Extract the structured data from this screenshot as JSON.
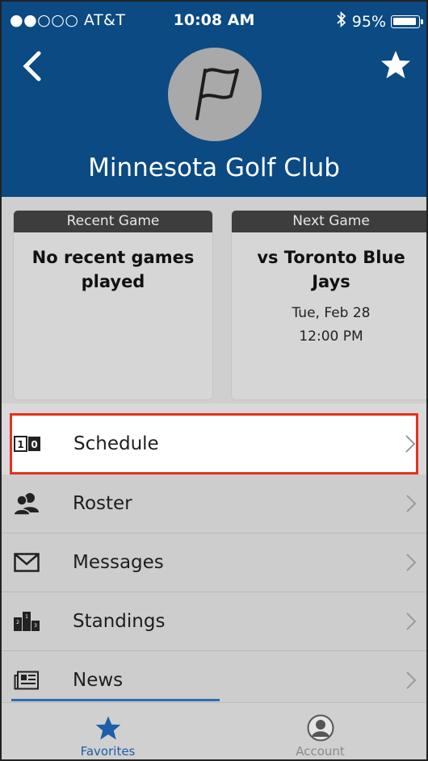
{
  "status_bar": {
    "carrier": "●●○○○ AT&T",
    "time": "10:08 AM",
    "battery": "95%"
  },
  "header": {
    "team_name": "Minnesota Golf Club",
    "back_icon": "chevron-left-icon",
    "favorite_icon": "star-icon",
    "logo_icon": "flag-icon"
  },
  "recent_game": {
    "label": "Recent Game",
    "text": "No recent games played"
  },
  "next_game": {
    "label": "Next Game",
    "opponent": "vs Toronto Blue Jays",
    "date": "Tue, Feb 28",
    "time": "12:00 PM"
  },
  "menu": {
    "items": [
      {
        "label": "Schedule",
        "icon": "scoreboard-icon"
      },
      {
        "label": "Roster",
        "icon": "people-icon"
      },
      {
        "label": "Messages",
        "icon": "envelope-icon"
      },
      {
        "label": "Standings",
        "icon": "podium-icon"
      },
      {
        "label": "News",
        "icon": "newspaper-icon"
      }
    ]
  },
  "tabs": {
    "favorites": "Favorites",
    "account": "Account"
  },
  "colors": {
    "header_bg": "#0b4a82",
    "highlight_border": "#e8301c",
    "active_tab": "#1f5ea8"
  }
}
